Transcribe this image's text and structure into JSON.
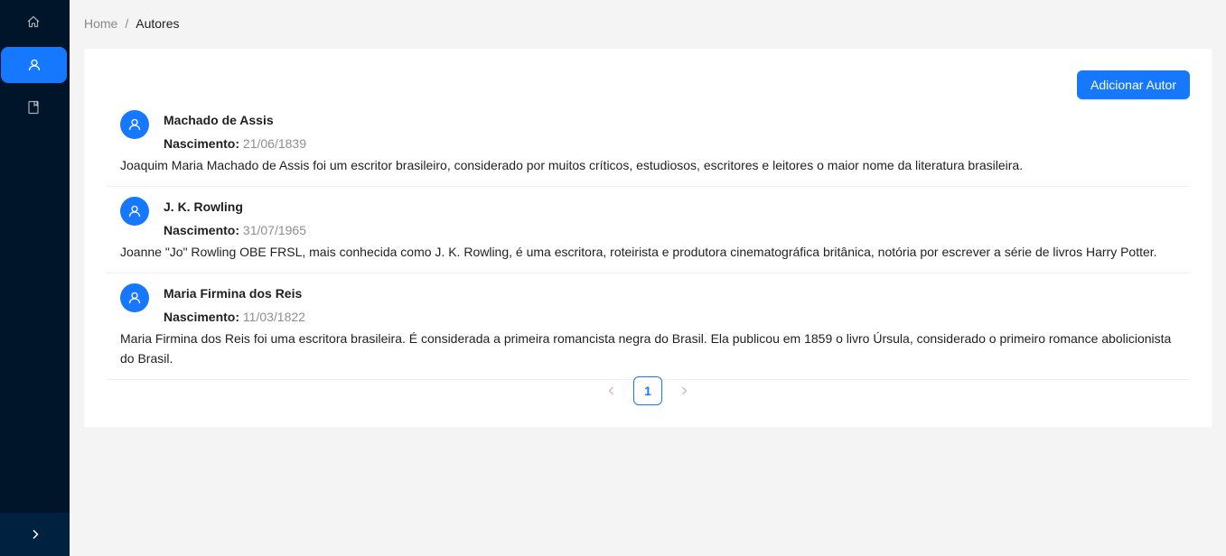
{
  "sidebar": {
    "items": [
      {
        "icon": "home-icon",
        "active": false
      },
      {
        "icon": "user-icon",
        "active": true
      },
      {
        "icon": "book-icon",
        "active": false
      }
    ],
    "trigger_icon": "chevron-right-icon"
  },
  "breadcrumb": {
    "home": "Home",
    "separator": "/",
    "current": "Autores"
  },
  "toolbar": {
    "add_label": "Adicionar Autor"
  },
  "authors": [
    {
      "name": "Machado de Assis",
      "birth_label": "Nascimento:",
      "birth_date": "21/06/1839",
      "bio": "Joaquim Maria Machado de Assis foi um escritor brasileiro, considerado por muitos críticos, estudiosos, escritores e leitores o maior nome da literatura brasileira."
    },
    {
      "name": "J. K. Rowling",
      "birth_label": "Nascimento:",
      "birth_date": "31/07/1965",
      "bio": "Joanne \"Jo\" Rowling OBE FRSL, mais conhecida como J. K. Rowling, é uma escritora, roteirista e produtora cinematográfica britânica, notória por escrever a série de livros Harry Potter."
    },
    {
      "name": "Maria Firmina dos Reis",
      "birth_label": "Nascimento:",
      "birth_date": "11/03/1822",
      "bio": "Maria Firmina dos Reis foi uma escritora brasileira. É considerada a primeira romancista negra do Brasil. Ela publicou em 1859 o livro Úrsula, considerado o primeiro romance abolicionista do Brasil."
    }
  ],
  "pagination": {
    "current_page": "1"
  },
  "colors": {
    "primary": "#1677ff",
    "sider": "#001529",
    "background": "#f4f4f4"
  }
}
